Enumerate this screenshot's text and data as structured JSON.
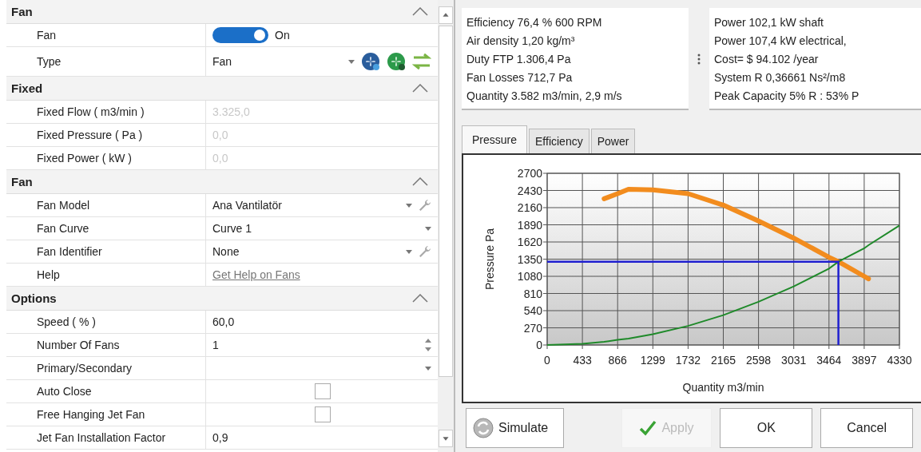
{
  "property_grid": {
    "sections": [
      {
        "title": "Fan",
        "expanded": true,
        "rows": [
          {
            "label": "Fan",
            "kind": "toggle",
            "on": true,
            "value": "On"
          },
          {
            "label": "Type",
            "kind": "type-combo",
            "value": "Fan"
          }
        ]
      },
      {
        "title": "Fixed",
        "expanded": true,
        "rows": [
          {
            "label": "Fixed Flow ( m3/min )",
            "kind": "text",
            "value": "3.325,0",
            "disabled": true
          },
          {
            "label": "Fixed Pressure ( Pa )",
            "kind": "text",
            "value": "0,0",
            "disabled": true
          },
          {
            "label": "Fixed Power ( kW )",
            "kind": "text",
            "value": "0,0",
            "disabled": true
          }
        ]
      },
      {
        "title": "Fan",
        "expanded": true,
        "rows": [
          {
            "label": "Fan Model",
            "kind": "combo-wrench",
            "value": "Ana Vantilatör"
          },
          {
            "label": "Fan Curve",
            "kind": "combo",
            "value": "Curve 1"
          },
          {
            "label": "Fan Identifier",
            "kind": "combo-wrench",
            "value": "None"
          },
          {
            "label": "Help",
            "kind": "link",
            "value": "Get Help on Fans"
          }
        ]
      },
      {
        "title": "Options",
        "expanded": true,
        "rows": [
          {
            "label": "Speed ( % )",
            "kind": "text",
            "value": "60,0",
            "disabled": false
          },
          {
            "label": "Number Of Fans",
            "kind": "spin",
            "value": "1"
          },
          {
            "label": "Primary/Secondary",
            "kind": "combo"
          },
          {
            "label": "Auto Close",
            "kind": "checkbox",
            "checked": false
          },
          {
            "label": "Free Hanging Jet Fan",
            "kind": "checkbox",
            "checked": false
          },
          {
            "label": "Jet Fan Installation Factor",
            "kind": "text",
            "value": "0,9",
            "disabled": false
          }
        ]
      }
    ]
  },
  "summary": {
    "left": [
      "Efficiency 76,4 %  600 RPM",
      "Air density  1,20 kg/m³",
      "Duty FTP 1.306,4 Pa",
      "Fan Losses 712,7 Pa",
      "Quantity 3.582 m3/min, 2,9 m/s"
    ],
    "right": [
      "Power 102,1 kW shaft",
      "Power 107,4 kW electrical,",
      "Cost=  $ 94.102 /year",
      "System R 0,36661 Ns²/m8",
      "Peak Capacity 5% R : 53% P"
    ]
  },
  "tabs": [
    {
      "label": "Pressure",
      "selected": true
    },
    {
      "label": "Efficiency",
      "selected": false
    },
    {
      "label": "Power",
      "selected": false
    }
  ],
  "chart_data": {
    "type": "line",
    "xlabel": "Quantity m3/min",
    "ylabel": "Pressure Pa",
    "x": [
      0,
      433,
      700,
      866,
      1000,
      1299,
      1732,
      2165,
      2598,
      3031,
      3464,
      3580,
      3580,
      3897,
      3950,
      4330
    ],
    "series": [
      {
        "color": "#f28c1e",
        "values": [
          null,
          null,
          2300,
          2380,
          2450,
          2440,
          2380,
          2200,
          1950,
          1680,
          1380,
          1310,
          1310,
          1080,
          1040,
          null
        ]
      },
      {
        "color": "#1f8a2a",
        "values": [
          0,
          20,
          50,
          80,
          100,
          170,
          300,
          470,
          680,
          920,
          1200,
          1310,
          1310,
          1520,
          1570,
          1880
        ]
      },
      {
        "color": "#2020d0",
        "values": [
          1310,
          1310,
          1310,
          1310,
          1310,
          1310,
          1310,
          1310,
          1310,
          1310,
          1310,
          1310,
          0,
          null,
          null,
          null
        ]
      }
    ],
    "grid": true,
    "xlim": [
      0,
      4330
    ],
    "ylim": [
      0,
      2700
    ],
    "xticks": [
      0,
      433,
      866,
      1299,
      1732,
      2165,
      2598,
      3031,
      3464,
      3897,
      4330
    ],
    "yticks": [
      0,
      270,
      540,
      810,
      1080,
      1350,
      1620,
      1890,
      2160,
      2430,
      2700
    ]
  },
  "buttons": [
    {
      "label": "Simulate",
      "kind": "simulate",
      "disabled": false
    },
    {
      "label": "Apply",
      "kind": "apply",
      "disabled": true
    },
    {
      "label": "OK",
      "kind": "plain",
      "disabled": false
    },
    {
      "label": "Cancel",
      "kind": "plain",
      "disabled": false
    }
  ]
}
